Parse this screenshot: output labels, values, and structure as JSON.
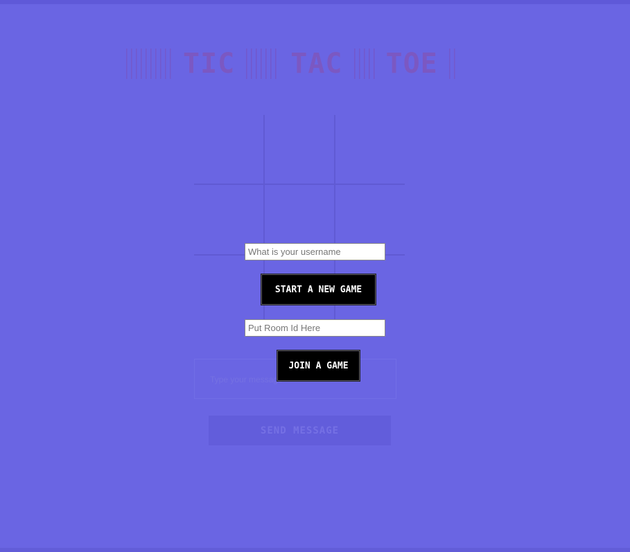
{
  "title": {
    "words": [
      "TIC",
      "TAC",
      "TOE"
    ]
  },
  "chat": {
    "placeholder": "Type your message",
    "send_label": "SEND MESSAGE"
  },
  "modal": {
    "username_placeholder": "What is your username",
    "start_label": "START A NEW GAME",
    "room_placeholder": "Put Room Id Here",
    "join_label": "JOIN A GAME"
  },
  "colors": {
    "background": "#6a65e3",
    "button": "#000000",
    "button_text": "#ffffff"
  }
}
